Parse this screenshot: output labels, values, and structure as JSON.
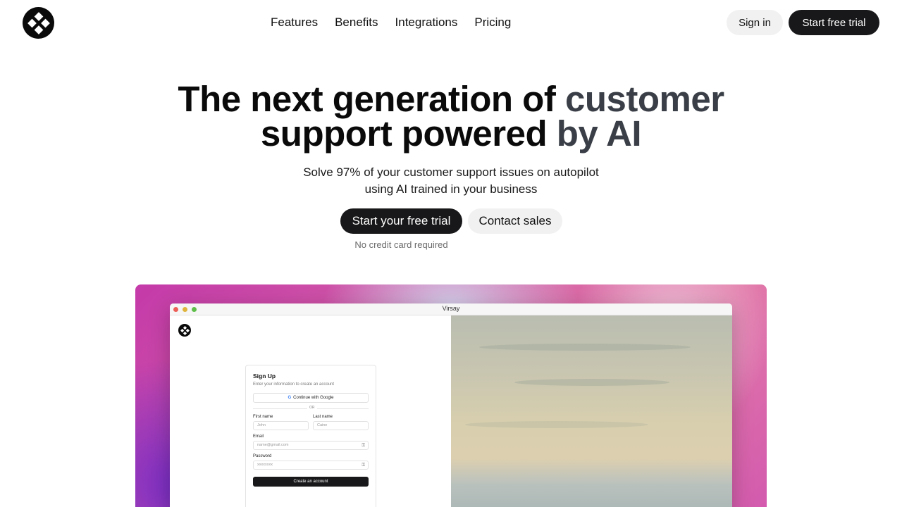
{
  "header": {
    "logo_icon": "diamond-grid-logo-icon",
    "nav": [
      "Features",
      "Benefits",
      "Integrations",
      "Pricing"
    ],
    "signin_label": "Sign in",
    "trial_label": "Start free trial"
  },
  "hero": {
    "title_line1_a": "The next generation of ",
    "title_line1_b": "customer",
    "title_line2_a": "support powered ",
    "title_line2_b": "by AI",
    "subtitle_line1": "Solve 97% of your customer support issues on autopilot",
    "subtitle_line2": "using AI trained in your business",
    "cta_primary": "Start your free trial",
    "cta_secondary": "Contact sales",
    "note": "No credit card required"
  },
  "showcase": {
    "window_title": "Virsay",
    "signup": {
      "title": "Sign Up",
      "subtitle": "Enter your information to create an account",
      "google_label": "Continue with Google",
      "or_label": "OR",
      "first_name_label": "First name",
      "first_name_placeholder": "John",
      "last_name_label": "Last name",
      "last_name_placeholder": "Caine",
      "email_label": "Email",
      "email_placeholder": "name@gmail.com",
      "password_label": "Password",
      "password_placeholder": "xxxxxxxx",
      "create_label": "Create an account"
    }
  },
  "colors": {
    "primary_button": "#18181a",
    "secondary_button": "#f1f1f2",
    "showcase_magenta": "#c43aa9"
  }
}
